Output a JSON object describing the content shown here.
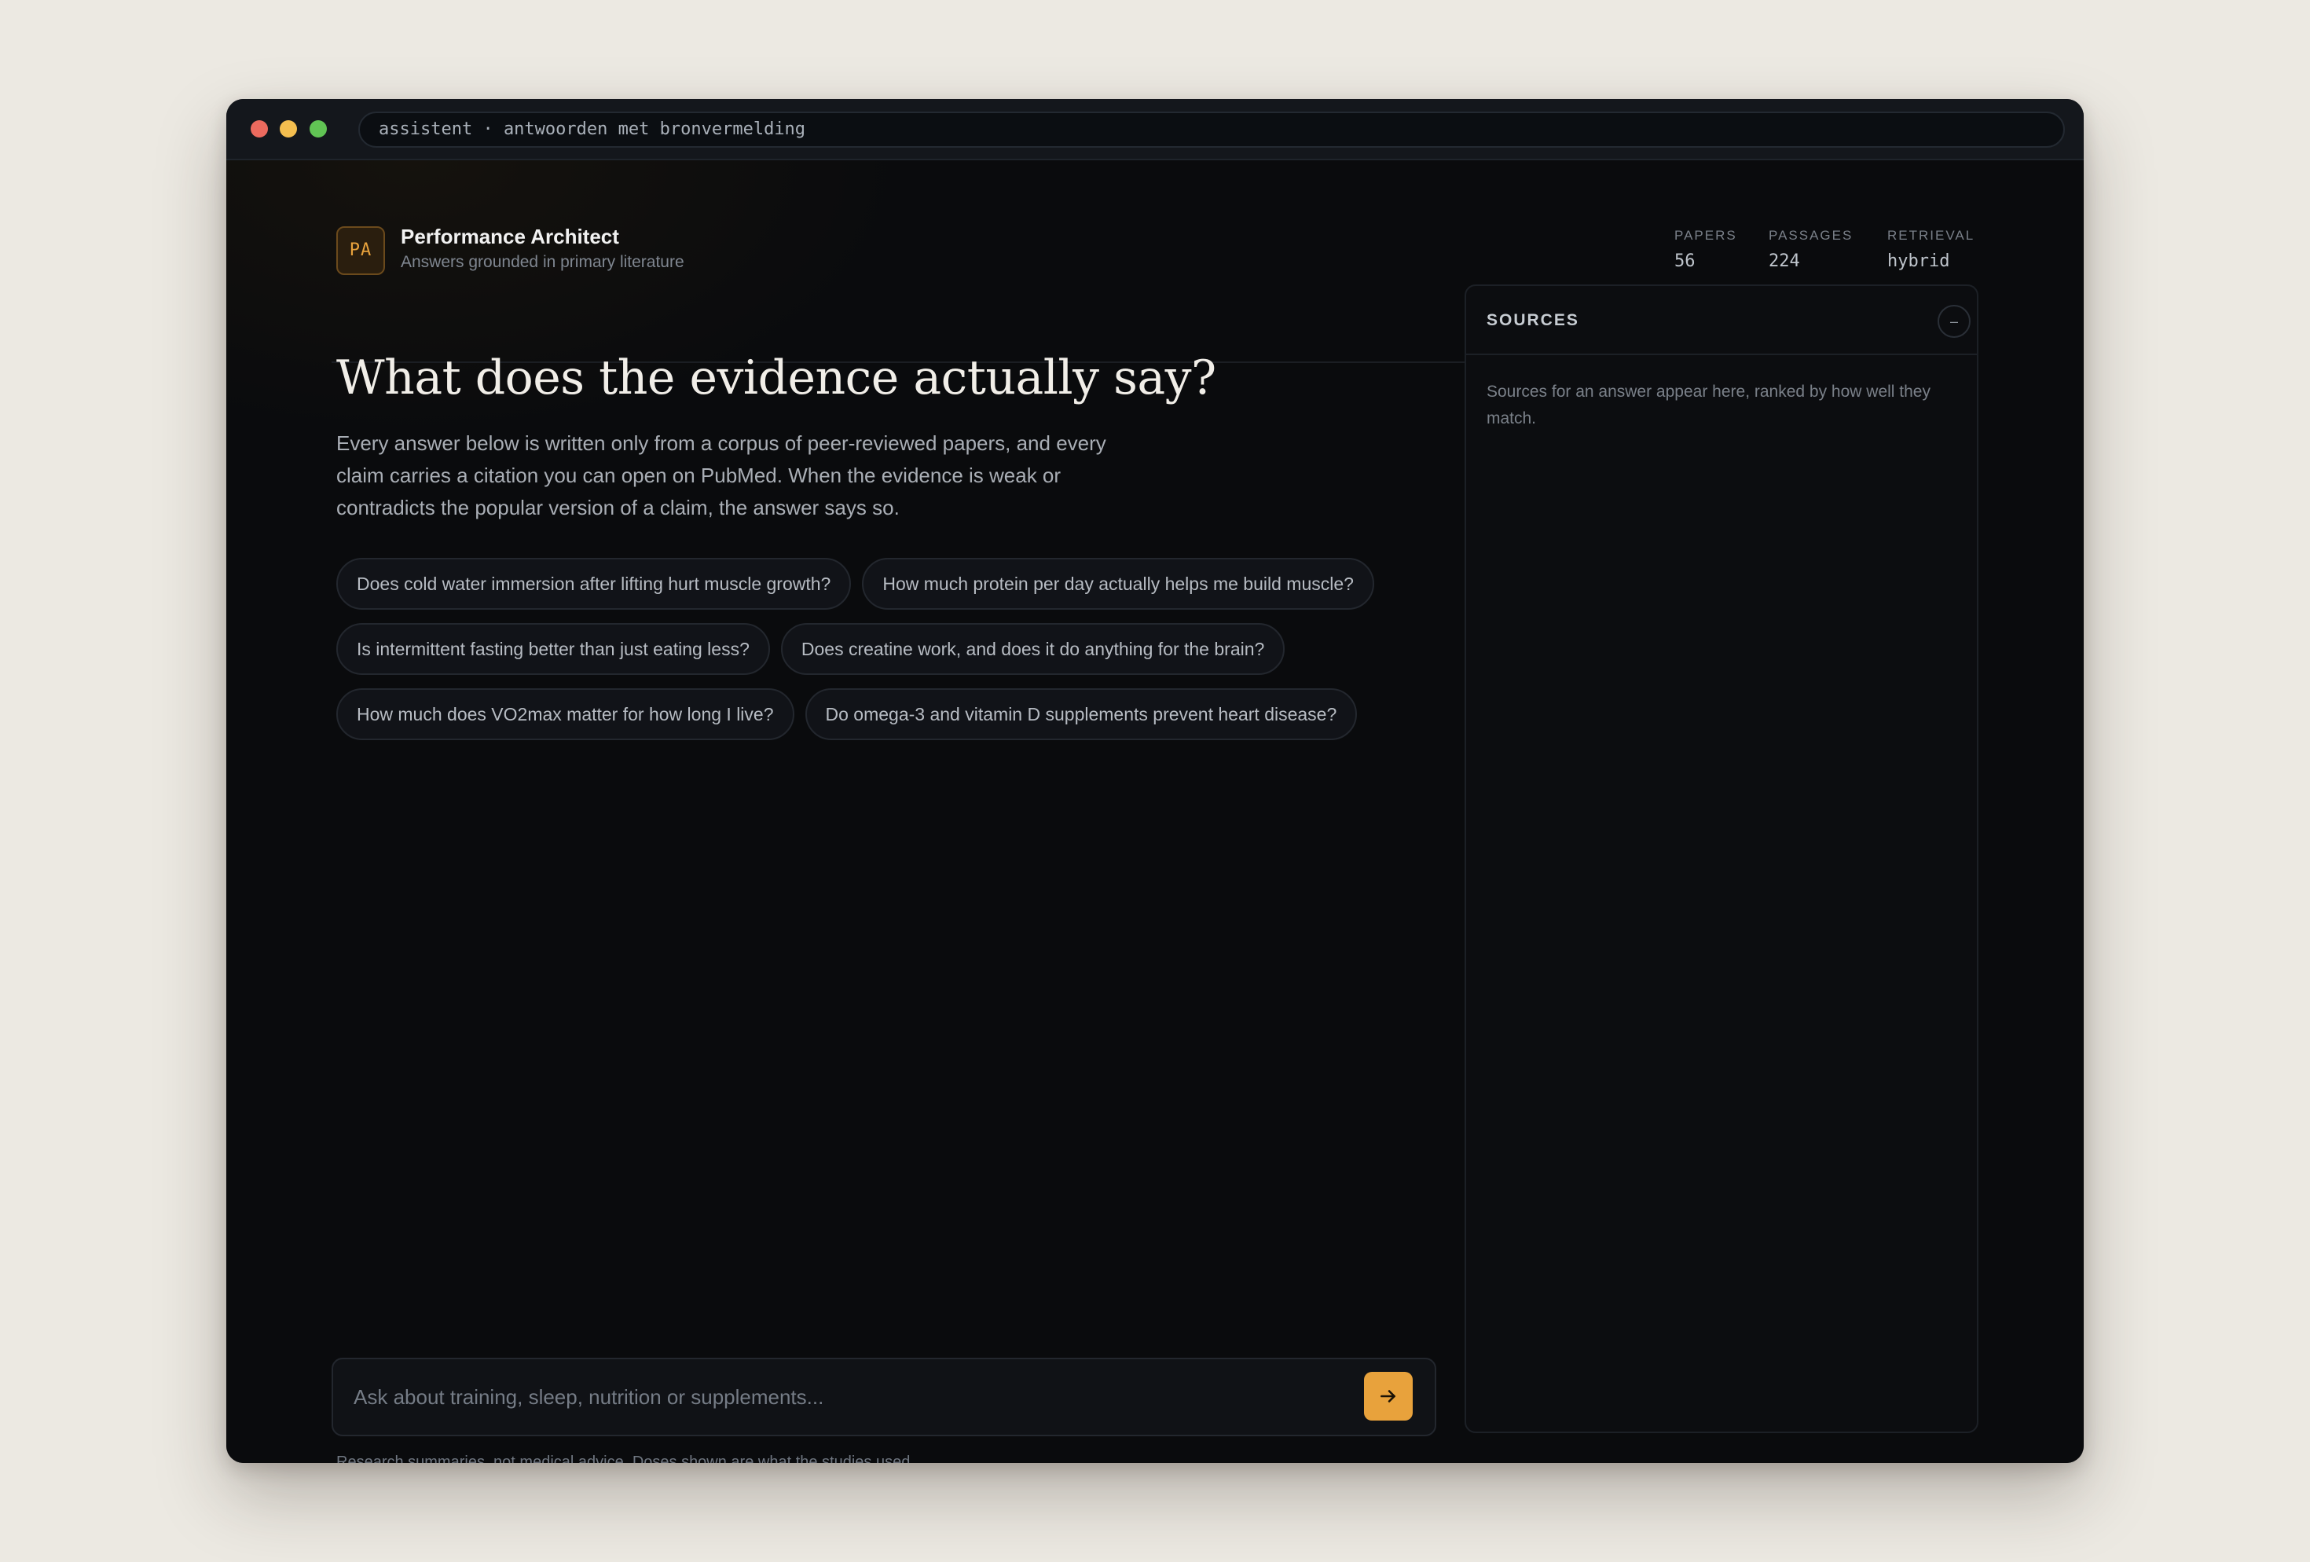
{
  "window": {
    "url": "assistent · antwoorden met bronvermelding"
  },
  "header": {
    "avatar_initials": "PA",
    "title": "Performance Architect",
    "subtitle": "Answers grounded in primary literature",
    "stats": [
      {
        "label": "PAPERS",
        "value": "56"
      },
      {
        "label": "PASSAGES",
        "value": "224"
      },
      {
        "label": "RETRIEVAL",
        "value": "hybrid"
      }
    ]
  },
  "main": {
    "heading": "What does the evidence actually say?",
    "intro": "Every answer below is written only from a corpus of peer-reviewed papers, and every claim carries a citation you can open on PubMed. When the evidence is weak or contradicts the popular version of a claim, the answer says so.",
    "suggestions": [
      "Does cold water immersion after lifting hurt muscle growth?",
      "How much protein per day actually helps me build muscle?",
      "Is intermittent fasting better than just eating less?",
      "Does creatine work, and does it do anything for the brain?",
      "How much does VO2max matter for how long I live?",
      "Do omega-3 and vitamin D supplements prevent heart disease?"
    ]
  },
  "composer": {
    "placeholder": "Ask about training, sleep, nutrition or supplements...",
    "value": "",
    "send_icon": "arrow-right-icon",
    "accent": "#e8a23c"
  },
  "disclaimer": "Research summaries, not medical advice. Doses shown are what the studies used.",
  "sources": {
    "title": "SOURCES",
    "collapse_symbol": "–",
    "empty_text": "Sources for an answer appear here, ranked by how well they match."
  }
}
